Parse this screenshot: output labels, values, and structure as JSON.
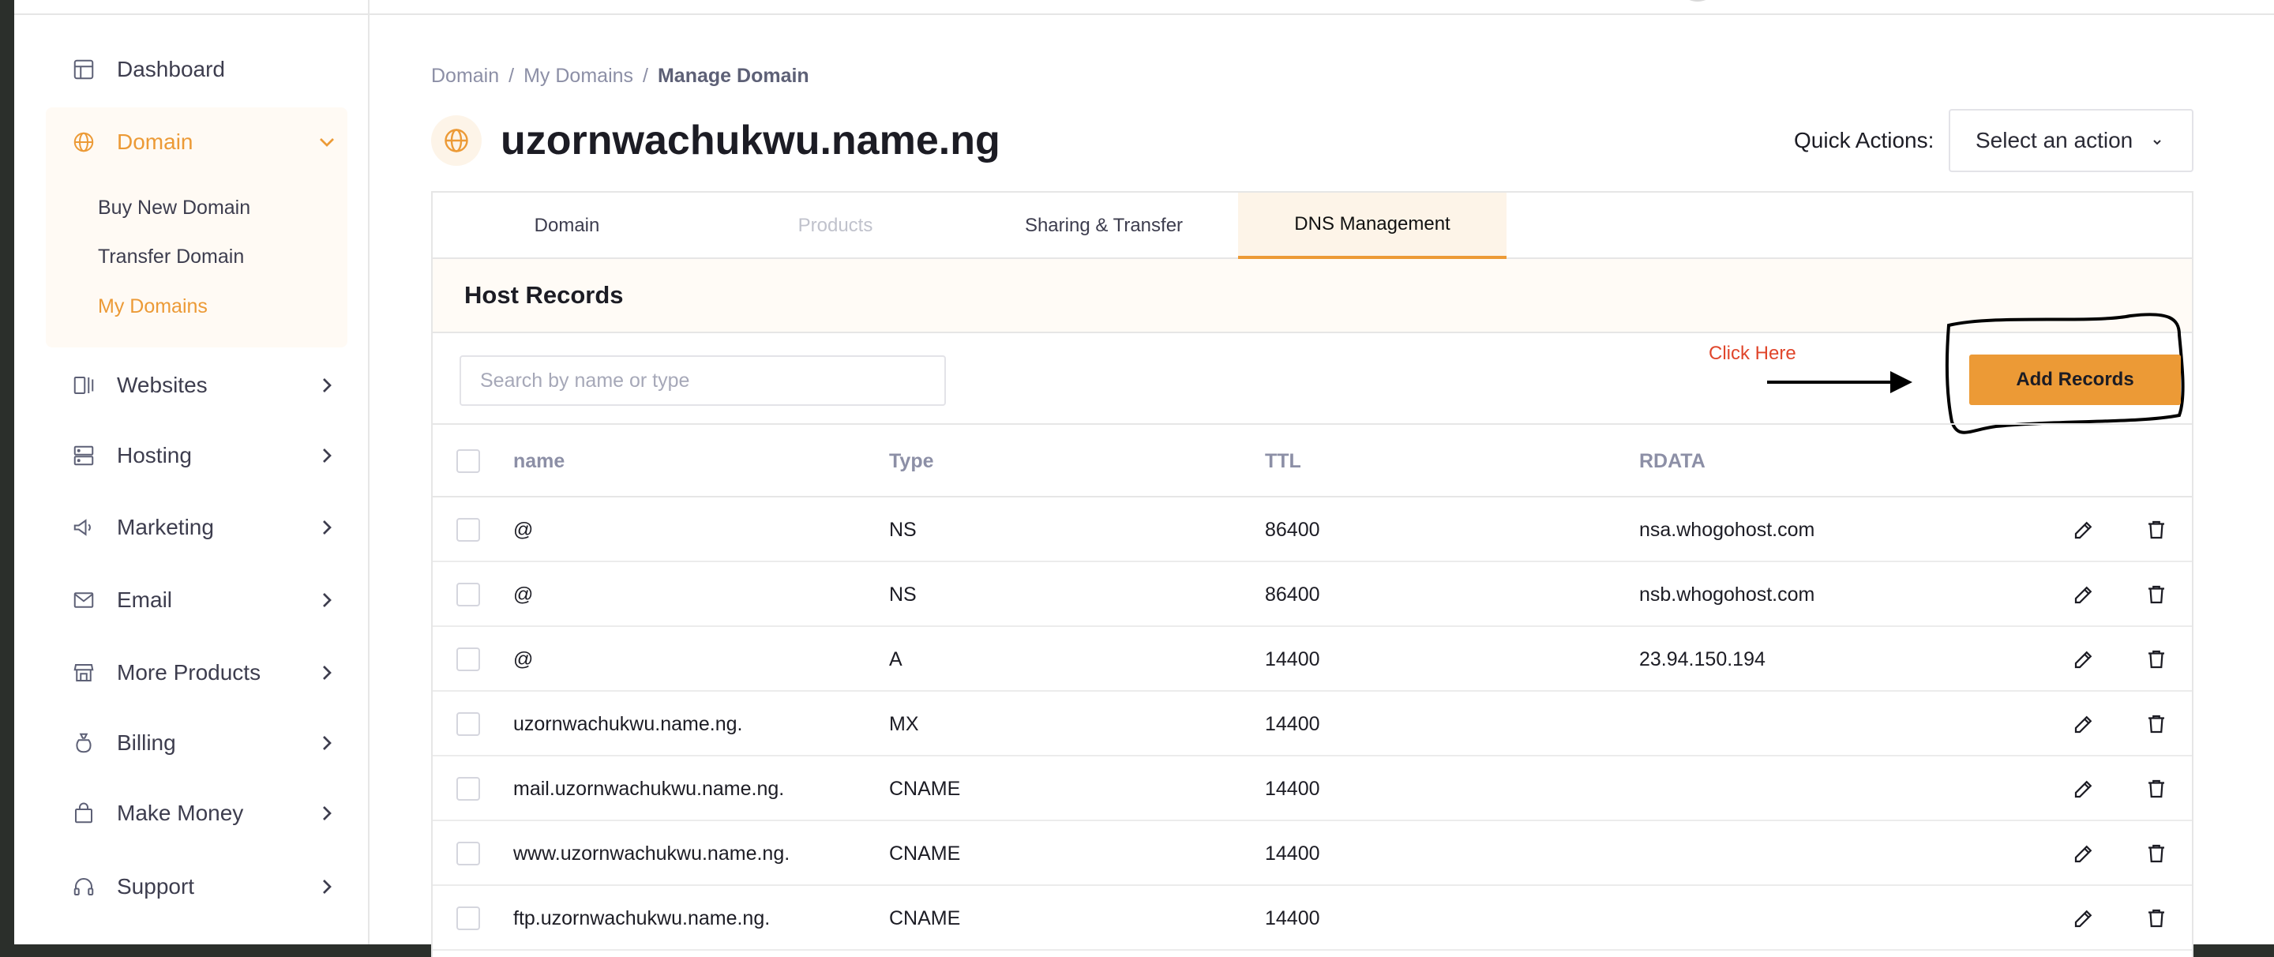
{
  "sidebar": {
    "items": [
      {
        "label": "Dashboard",
        "icon": "dashboard-icon"
      },
      {
        "label": "Domain",
        "icon": "globe-icon"
      },
      {
        "label": "Websites",
        "icon": "websites-icon"
      },
      {
        "label": "Hosting",
        "icon": "server-icon"
      },
      {
        "label": "Marketing",
        "icon": "megaphone-icon"
      },
      {
        "label": "Email",
        "icon": "mail-icon"
      },
      {
        "label": "More Products",
        "icon": "store-icon"
      },
      {
        "label": "Billing",
        "icon": "money-bag-icon"
      },
      {
        "label": "Make Money",
        "icon": "shopping-bag-icon"
      },
      {
        "label": "Support",
        "icon": "headset-icon"
      }
    ],
    "domain_sub": [
      "Buy New Domain",
      "Transfer Domain",
      "My Domains"
    ]
  },
  "breadcrumb": [
    "Domain",
    "My Domains",
    "Manage Domain"
  ],
  "page_title": "uzornwachukwu.name.ng",
  "quick_actions": {
    "label": "Quick Actions:",
    "value": "Select an action"
  },
  "tabs": [
    "Domain",
    "Products",
    "Sharing & Transfer",
    "DNS Management"
  ],
  "host_records": {
    "title": "Host Records",
    "search_placeholder": "Search by name or type",
    "add_button": "Add Records",
    "annotation": "Click Here",
    "columns": [
      "name",
      "Type",
      "TTL",
      "RDATA"
    ],
    "rows": [
      {
        "name": "@",
        "type": "NS",
        "ttl": "86400",
        "rdata": "nsa.whogohost.com"
      },
      {
        "name": "@",
        "type": "NS",
        "ttl": "86400",
        "rdata": "nsb.whogohost.com"
      },
      {
        "name": "@",
        "type": "A",
        "ttl": "14400",
        "rdata": "23.94.150.194"
      },
      {
        "name": "uzornwachukwu.name.ng.",
        "type": "MX",
        "ttl": "14400",
        "rdata": ""
      },
      {
        "name": "mail.uzornwachukwu.name.ng.",
        "type": "CNAME",
        "ttl": "14400",
        "rdata": ""
      },
      {
        "name": "www.uzornwachukwu.name.ng.",
        "type": "CNAME",
        "ttl": "14400",
        "rdata": ""
      },
      {
        "name": "ftp.uzornwachukwu.name.ng.",
        "type": "CNAME",
        "ttl": "14400",
        "rdata": ""
      }
    ]
  },
  "colors": {
    "accent": "#ec9a36",
    "annotation": "#e0462b"
  }
}
